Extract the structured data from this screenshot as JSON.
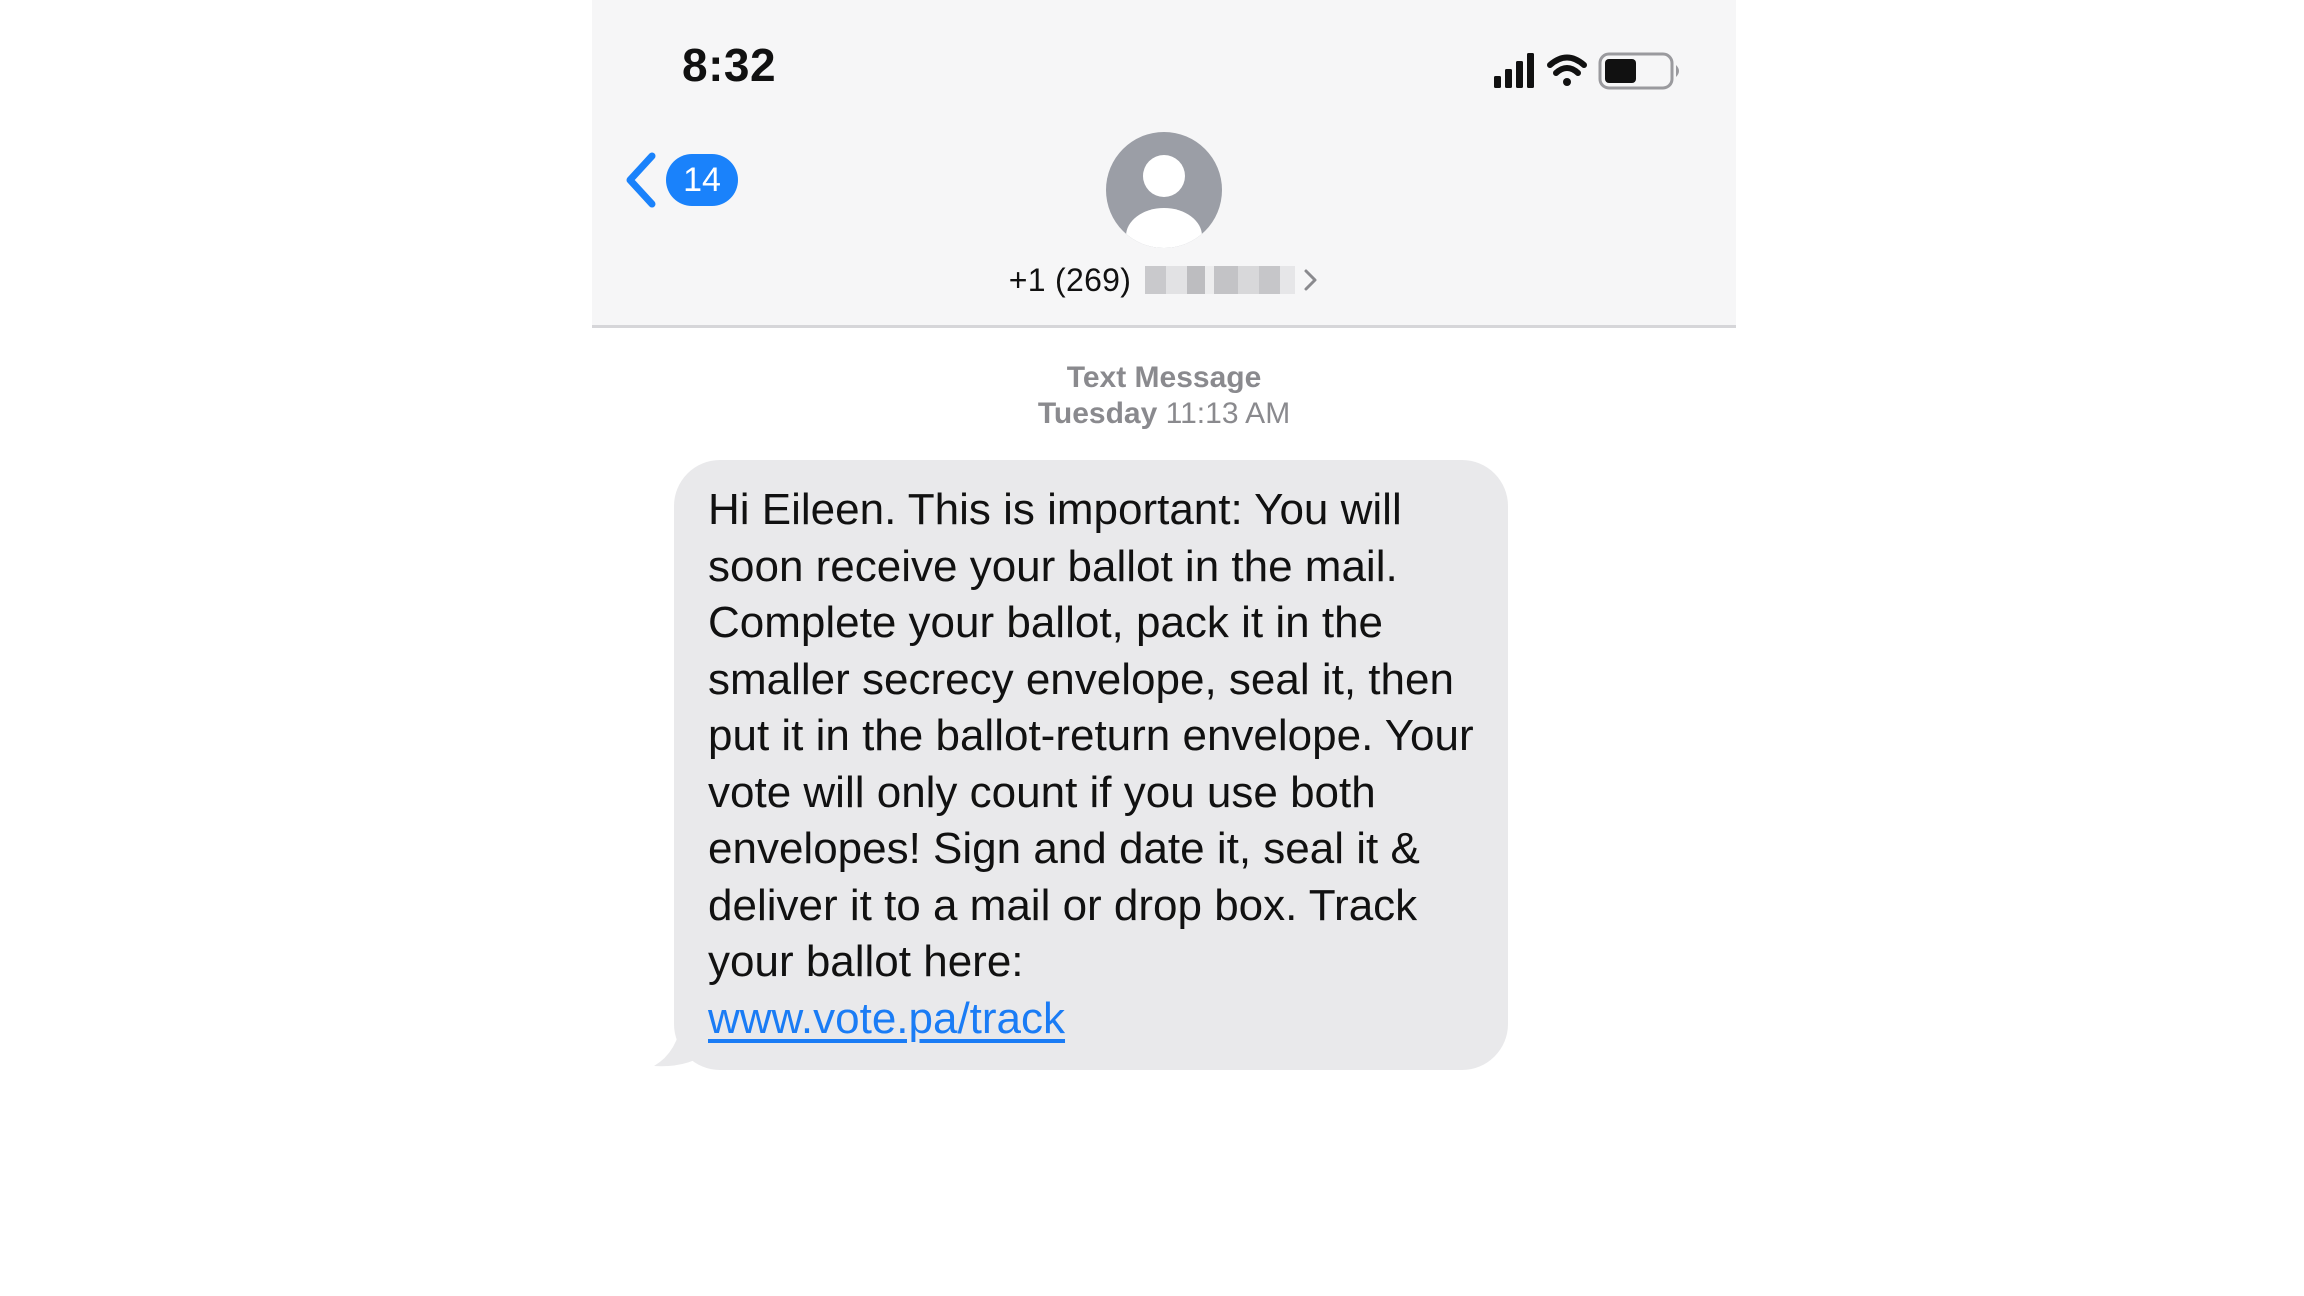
{
  "status_bar": {
    "time": "8:32",
    "icons": [
      "cellular-signal-icon",
      "wifi-icon",
      "battery-icon"
    ],
    "battery_level": 0.5
  },
  "nav": {
    "back_icon": "chevron-left-icon",
    "unread_count": "14",
    "avatar_icon": "person-silhouette-icon",
    "contact_number": "+1 (269)",
    "contact_chevron_icon": "chevron-right-icon"
  },
  "conversation": {
    "service_label": "Text Message",
    "day": "Tuesday",
    "time": "11:13 AM",
    "message": {
      "text": "Hi Eileen. This is important: You will soon receive your ballot in the mail. Complete your ballot, pack it in the smaller secrecy envelope, seal it, then put it in the ballot-return envelope. Your vote will only count if you use both envelopes! Sign and date it, seal it & deliver it to a mail or drop box. Track your ballot here:",
      "link": "www.vote.pa/track"
    }
  },
  "colors": {
    "header_bg": "#f6f6f7",
    "accent_blue": "#1a82fb",
    "bubble_bg": "#e9e9eb",
    "link_blue": "#1a7cf5",
    "meta_gray": "#8a8a8e"
  }
}
